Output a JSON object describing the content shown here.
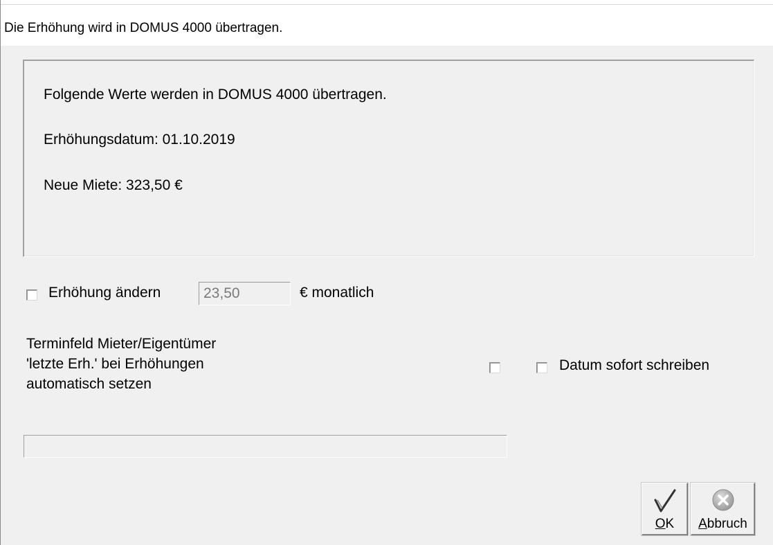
{
  "window": {
    "title": "Die Erhöhung wird in DOMUS 4000 übertragen."
  },
  "info": {
    "line1": "Folgende Werte werden in DOMUS 4000 übertragen.",
    "line2": "Erhöhungsdatum: 01.10.2019",
    "line3": "Neue Miete: 323,50 €"
  },
  "change": {
    "checkbox_label": "Erhöhung ändern",
    "checked": false,
    "amount_value": "23,50",
    "unit_label": "€ monatlich"
  },
  "terminfeld": {
    "line1": "Terminfeld Mieter/Eigentümer",
    "line2": "'letzte Erh.' bei Erhöhungen",
    "line3": "automatisch setzen",
    "checked": false
  },
  "datum": {
    "label": "Datum sofort schreiben",
    "checked": false
  },
  "progress": {
    "value": 0
  },
  "buttons": {
    "ok": {
      "accel": "O",
      "rest": "K"
    },
    "cancel": {
      "accel": "A",
      "rest": "bbruch"
    }
  },
  "colors": {
    "ok_check": "#333333",
    "cancel_circle": "#b4b4b4"
  }
}
